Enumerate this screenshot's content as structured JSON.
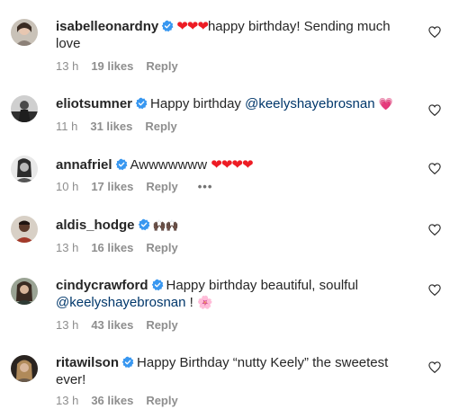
{
  "comments": [
    {
      "username": "isabelleonardny",
      "emoji_before": "❤❤❤",
      "text": "happy birthday! Sending much love",
      "time": "13 h",
      "likes": "19 likes",
      "reply": "Reply",
      "avatar_color": "#c9c2b8"
    },
    {
      "username": "eliotsumner",
      "text": "Happy birthday ",
      "mention": "@keelyshayebrosnan",
      "emoji_after": "💗",
      "time": "11 h",
      "likes": "31 likes",
      "reply": "Reply",
      "avatar_color": "#3a3a3a"
    },
    {
      "username": "annafriel",
      "text": "Awwwwwww ",
      "emoji_after": "❤❤❤❤",
      "time": "10 h",
      "likes": "17 likes",
      "reply": "Reply",
      "more": "•••",
      "avatar_color": "#5a5a5a"
    },
    {
      "username": "aldis_hodge",
      "emoji_after": "🙌🏿🙌🏿",
      "time": "13 h",
      "likes": "16 likes",
      "reply": "Reply",
      "avatar_color": "#6b4a3a"
    },
    {
      "username": "cindycrawford",
      "text": "Happy birthday beautiful, soulful",
      "mention": "@keelyshayebrosnan",
      "text_after": " ! ",
      "emoji_after": "🌸",
      "time": "13 h",
      "likes": "43 likes",
      "reply": "Reply",
      "avatar_color": "#6f7a6a"
    },
    {
      "username": "ritawilson",
      "text": "Happy Birthday “nutty Keely” the sweetest ever!",
      "time": "13 h",
      "likes": "36 likes",
      "reply": "Reply",
      "avatar_color": "#4a3c34"
    }
  ],
  "colors": {
    "verified_badge": "#3897f0",
    "mention": "#00376b",
    "meta": "#8e8e8e"
  },
  "icons": {
    "verified": "verified-badge-icon",
    "like": "heart-outline-icon",
    "more": "more-options-icon"
  }
}
